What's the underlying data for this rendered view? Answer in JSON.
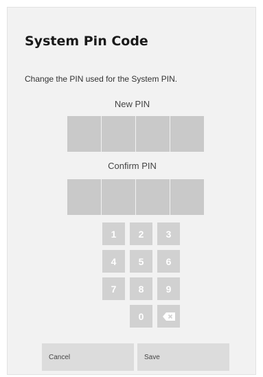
{
  "dialog": {
    "title": "System Pin Code",
    "description": "Change the PIN used for the System PIN."
  },
  "new_pin": {
    "label": "New PIN",
    "digits": [
      "",
      "",
      "",
      ""
    ]
  },
  "confirm_pin": {
    "label": "Confirm PIN",
    "digits": [
      "",
      "",
      "",
      ""
    ]
  },
  "keypad": {
    "keys": [
      "1",
      "2",
      "3",
      "4",
      "5",
      "6",
      "7",
      "8",
      "9",
      "0"
    ],
    "backspace_icon": "backspace-icon"
  },
  "footer": {
    "cancel_label": "Cancel",
    "save_label": "Save"
  },
  "colors": {
    "dialog_bg": "#f2f2f2",
    "pin_box": "#c9c9c9",
    "key_bg": "#d1d1d1",
    "button_bg": "#dcdcdc"
  }
}
